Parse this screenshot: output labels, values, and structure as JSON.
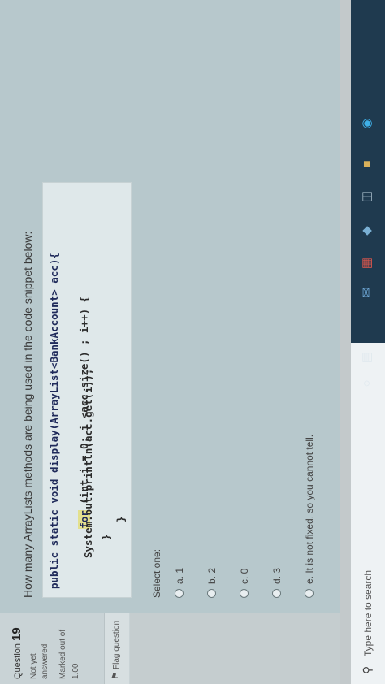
{
  "info_panel": {
    "question_prefix": "Question",
    "question_number": "19",
    "status_line1": "Not yet",
    "status_line2": "answered",
    "marked_line": "Marked out of",
    "marked_value": "1.00",
    "flag_label": "Flag question"
  },
  "question": {
    "text": "How many ArrayLists methods are being used in the code snippet below:",
    "code": {
      "line1": "public static void display(ArrayList<BankAccount> acc){",
      "line2_kw": "for",
      "line2_rest": " (int i = 0; i <acc.size() ; i++) {",
      "line3": "System.out.println(acc.get(i));",
      "line4": "}",
      "line5": "}"
    },
    "select_label": "Select one:",
    "options": [
      "a. 1",
      "b. 2",
      "c. 0",
      "d. 3",
      "e. It is not fixed, so you cannot tell."
    ]
  },
  "taskbar": {
    "search_placeholder": "Type here to search"
  },
  "colors": {
    "card": "#b7c8cc",
    "code_bg": "#dfe8ea",
    "taskbar": "#1f3a4f"
  }
}
